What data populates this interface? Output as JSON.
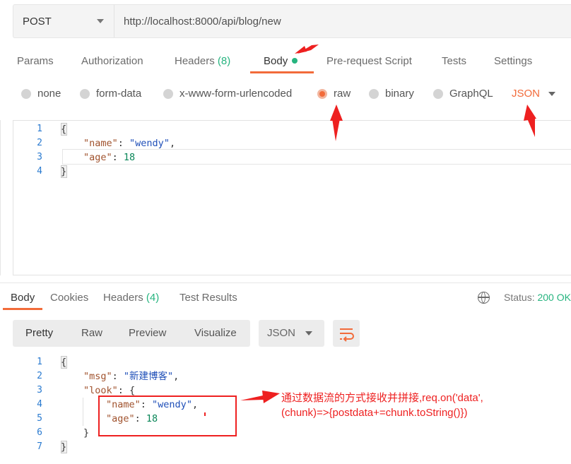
{
  "request": {
    "method": "POST",
    "url": "http://localhost:8000/api/blog/new"
  },
  "request_tabs": [
    {
      "label": "Params"
    },
    {
      "label": "Authorization"
    },
    {
      "label": "Headers",
      "count": "(8)"
    },
    {
      "label": "Body"
    },
    {
      "label": "Pre-request Script"
    },
    {
      "label": "Tests"
    },
    {
      "label": "Settings"
    }
  ],
  "body_types": [
    {
      "label": "none",
      "checked": false
    },
    {
      "label": "form-data",
      "checked": false
    },
    {
      "label": "x-www-form-urlencoded",
      "checked": false
    },
    {
      "label": "raw",
      "checked": true
    },
    {
      "label": "binary",
      "checked": false
    },
    {
      "label": "GraphQL",
      "checked": false
    }
  ],
  "raw_format": "JSON",
  "request_body": {
    "line_numbers": [
      "1",
      "2",
      "3",
      "4"
    ],
    "brace_open": "{",
    "name_key": "\"name\"",
    "name_value": "\"wendy\"",
    "age_key": "\"age\"",
    "age_value": "18",
    "brace_close": "}"
  },
  "response_tabs": [
    {
      "label": "Body"
    },
    {
      "label": "Cookies"
    },
    {
      "label": "Headers",
      "count": "(4)"
    },
    {
      "label": "Test Results"
    }
  ],
  "status": {
    "label": "Status:",
    "value": "200 OK"
  },
  "view_modes": [
    "Pretty",
    "Raw",
    "Preview",
    "Visualize"
  ],
  "response_format": "JSON",
  "response_body": {
    "line_numbers": [
      "1",
      "2",
      "3",
      "4",
      "5",
      "6",
      "7"
    ],
    "brace_open": "{",
    "msg_key": "\"msg\"",
    "msg_value": "\"新建博客\"",
    "look_key": "\"look\"",
    "name_key": "\"name\"",
    "name_value": "\"wendy\"",
    "age_key": "\"age\"",
    "age_value": "18",
    "inner_close": "}",
    "brace_close": "}"
  },
  "annotation": {
    "line1": "通过数据流的方式接收并拼接,req.on('data',",
    "line2": "(chunk)=>{postdata+=chunk.toString()})"
  },
  "colors": {
    "accent": "#f26b3a",
    "success": "#26b47f",
    "annotation": "#ee2020"
  }
}
